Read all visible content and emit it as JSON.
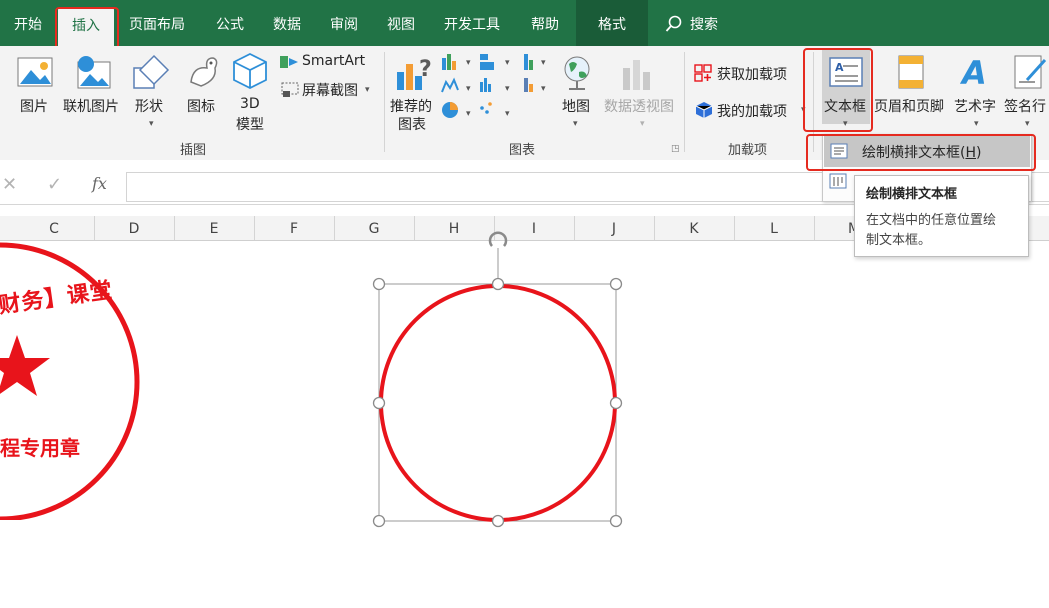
{
  "tabs": {
    "home": "开始",
    "insert": "插入",
    "page_layout": "页面布局",
    "formulas": "公式",
    "data": "数据",
    "review": "审阅",
    "view": "视图",
    "developer": "开发工具",
    "help": "帮助",
    "format": "格式",
    "search": "搜索"
  },
  "ribbon": {
    "pictures": "图片",
    "online_pictures": "联机图片",
    "shapes": "形状",
    "icons": "图标",
    "model3d_line1": "3D",
    "model3d_line2": "模型",
    "smartart": "SmartArt",
    "screenshot": "屏幕截图",
    "illustrations_group": "插图",
    "recommended_line1": "推荐的",
    "recommended_line2": "图表",
    "maps": "地图",
    "pivotchart": "数据透视图",
    "charts_group": "图表",
    "get_addins": "获取加载项",
    "my_addins": "我的加载项",
    "addins_group": "加载项",
    "textbox": "文本框",
    "header_footer": "页眉和页脚",
    "wordart": "艺术字",
    "signature": "签名行"
  },
  "dropdown": {
    "draw_horizontal": "绘制横排文本框(",
    "hotkey": "H",
    "close_paren": ")"
  },
  "tooltip": {
    "title": "绘制横排文本框",
    "desc_line1": "在文档中的任意位置绘",
    "desc_line2": "制文本框。"
  },
  "formula_bar": {
    "fx": "fx",
    "cancel": "✕",
    "enter": "✓"
  },
  "columns": [
    "C",
    "D",
    "E",
    "F",
    "G",
    "H",
    "I",
    "J",
    "K",
    "L",
    "M"
  ],
  "stamp": {
    "arc_text": "财务】课堂",
    "bottom_text": "程专用章",
    "color": "#e8141b"
  },
  "colors": {
    "accent": "#217346",
    "highlight": "#e52a1f"
  }
}
